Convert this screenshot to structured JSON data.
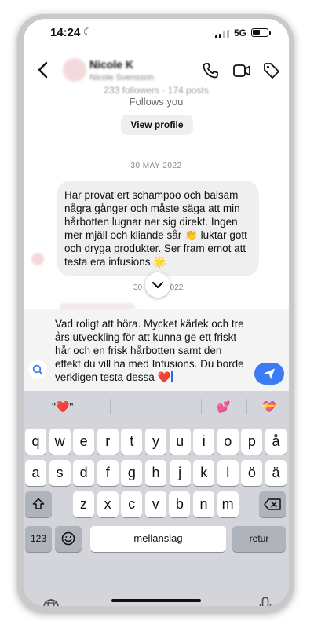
{
  "status_bar": {
    "time": "14:24",
    "network": "5G"
  },
  "header": {
    "name": "Nicole K",
    "subtitle": "Nicole Svensson"
  },
  "profile_intro": {
    "followers_text": "233 followers · 174 posts",
    "follows_text": "Follows you",
    "view_profile_label": "View profile"
  },
  "messages": {
    "date_label": "30 MAY 2022",
    "incoming_text": "Har provat ert schampoo och balsam några gånger och måste säga att min hårbotten lugnar ner sig direkt. Ingen mer mjäll och kliande sår 👏 luktar gott och dryga produkter. Ser fram emot att testa era infusions 🌟",
    "second_date_left": "30",
    "second_date_right": "2022"
  },
  "composer": {
    "text": "Vad roligt att höra. Mycket kärlek och tre års utveckling för att kunna ge ett friskt hår och en frisk hårbotten samt den effekt du vill ha med Infusions. Du borde verkligen testa dessa ❤️"
  },
  "keyboard": {
    "suggestions": [
      "\"❤️\"",
      "💕",
      "💝"
    ],
    "row1": [
      "q",
      "w",
      "e",
      "r",
      "t",
      "y",
      "u",
      "i",
      "o",
      "p",
      "å"
    ],
    "row2": [
      "a",
      "s",
      "d",
      "f",
      "g",
      "h",
      "j",
      "k",
      "l",
      "ö",
      "ä"
    ],
    "row3": [
      "z",
      "x",
      "c",
      "v",
      "b",
      "n",
      "m"
    ],
    "numbers_label": "123",
    "space_label": "mellanslag",
    "return_label": "retur"
  },
  "colors": {
    "accent": "#3d7bf5",
    "bubble": "#efefef",
    "keyboard": "#d3d5da"
  }
}
